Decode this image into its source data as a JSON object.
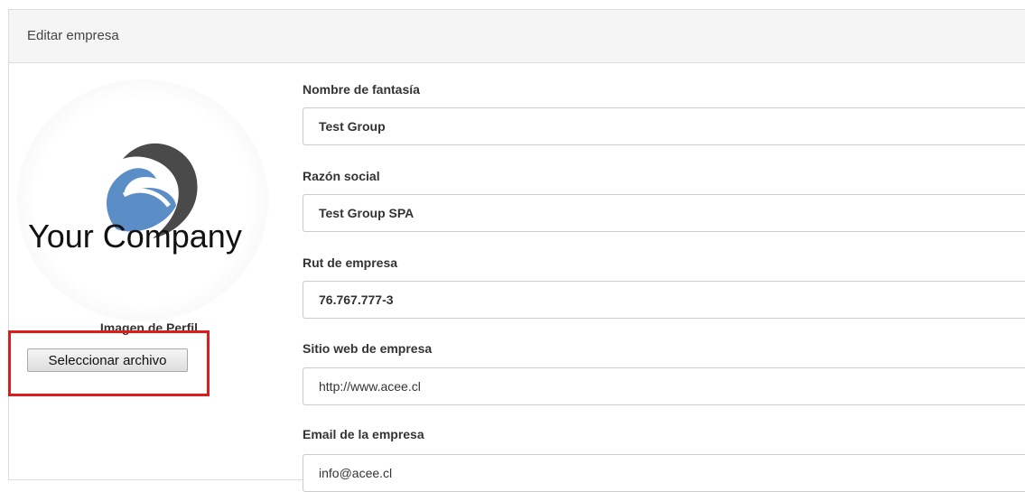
{
  "panel": {
    "title": "Editar empresa"
  },
  "profile": {
    "logo_text": "Your Company",
    "label": "Imagen de Perfil",
    "file_button": "Seleccionar archivo"
  },
  "fields": [
    {
      "label": "Nombre de fantasía",
      "value": "Test Group"
    },
    {
      "label": "Razón social",
      "value": "Test Group SPA"
    },
    {
      "label": "Rut de empresa",
      "value": "76.767.777-3"
    },
    {
      "label": "Sitio web de empresa",
      "value": "http://www.acee.cl"
    },
    {
      "label": "Email de la empresa",
      "value": "info@acee.cl"
    }
  ],
  "colors": {
    "highlight": "#e01b1b",
    "logo_blue": "#5b8dc6",
    "logo_gray": "#4a4a4a"
  }
}
